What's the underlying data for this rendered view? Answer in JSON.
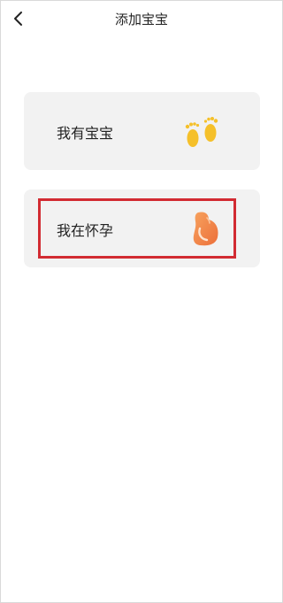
{
  "header": {
    "title": "添加宝宝",
    "back_icon": "chevron-left-icon"
  },
  "options": [
    {
      "label": "我有宝宝",
      "icon": "baby-feet-icon",
      "icon_color": "#f5c02a"
    },
    {
      "label": "我在怀孕",
      "icon": "pregnant-belly-icon",
      "icon_color": "#f07a3c"
    }
  ],
  "colors": {
    "card_background": "#f2f2f2",
    "highlight_border": "#d22b32"
  }
}
